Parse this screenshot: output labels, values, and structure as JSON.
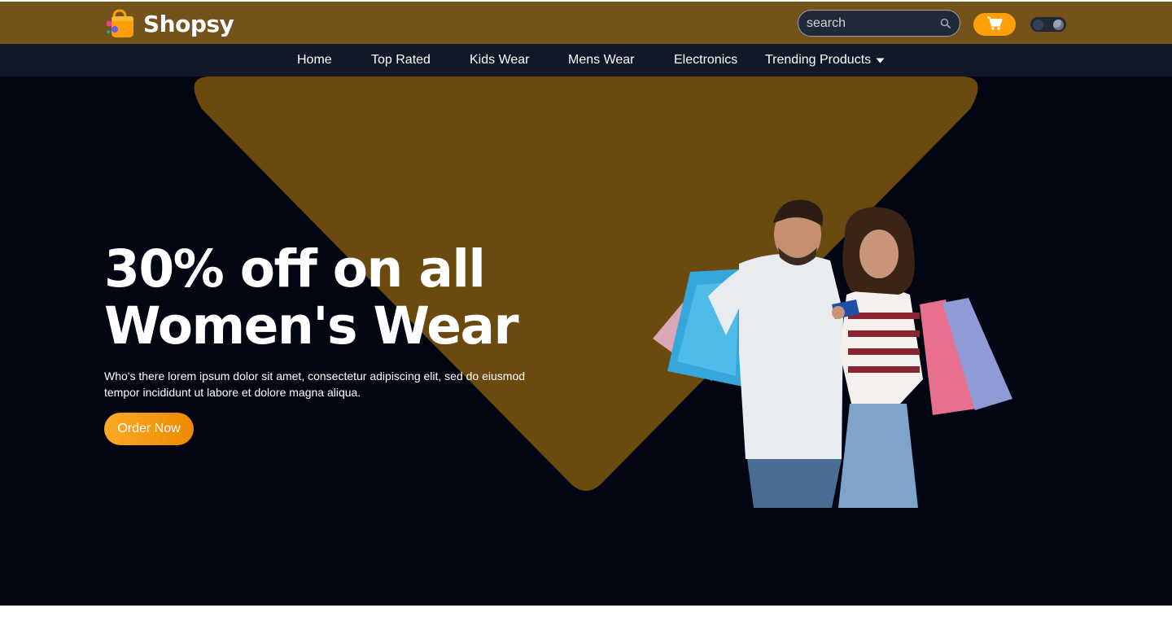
{
  "header": {
    "brand_name": "Shopsy",
    "search_placeholder": "search",
    "brand_color": "#74521c",
    "accent_color": "#fe9f0a",
    "icons": [
      "shopping-bag-icon",
      "search-icon",
      "cart-icon",
      "theme-toggle"
    ]
  },
  "nav": {
    "items": [
      {
        "label": "Home"
      },
      {
        "label": "Top Rated"
      },
      {
        "label": "Kids Wear"
      },
      {
        "label": "Mens Wear"
      },
      {
        "label": "Electronics"
      },
      {
        "label": "Trending Products",
        "icon": "caret-down-icon"
      }
    ]
  },
  "hero": {
    "title_line1": "30% off on all",
    "title_line2": "Women's Wear",
    "description": "Who's there lorem ipsum dolor sit amet, consectetur adipiscing elit, sed do eiusmod tempor incididunt ut labore et dolore magna aliqua.",
    "cta_label": "Order Now",
    "background_color": "#020612",
    "shape_color": "#6b4a10",
    "image": "couple-with-shopping-bags"
  }
}
